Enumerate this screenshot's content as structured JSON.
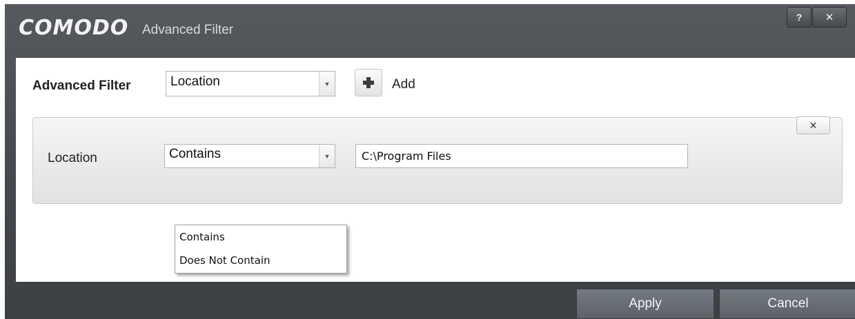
{
  "window": {
    "brand": "COMODO",
    "title": "Advanced Filter",
    "help_label": "?",
    "close_label": "✕"
  },
  "filter": {
    "label": "Advanced Filter",
    "selected": "Location",
    "dropdown_icon": "▼",
    "add_label": "Add"
  },
  "condition_row": {
    "remove_label": "✕",
    "field_label": "Location",
    "operator_selected": "Contains",
    "value": "C:\\Program Files",
    "operator_options": [
      "Contains",
      "Does Not Contain"
    ]
  },
  "footer": {
    "apply_label": "Apply",
    "cancel_label": "Cancel"
  }
}
